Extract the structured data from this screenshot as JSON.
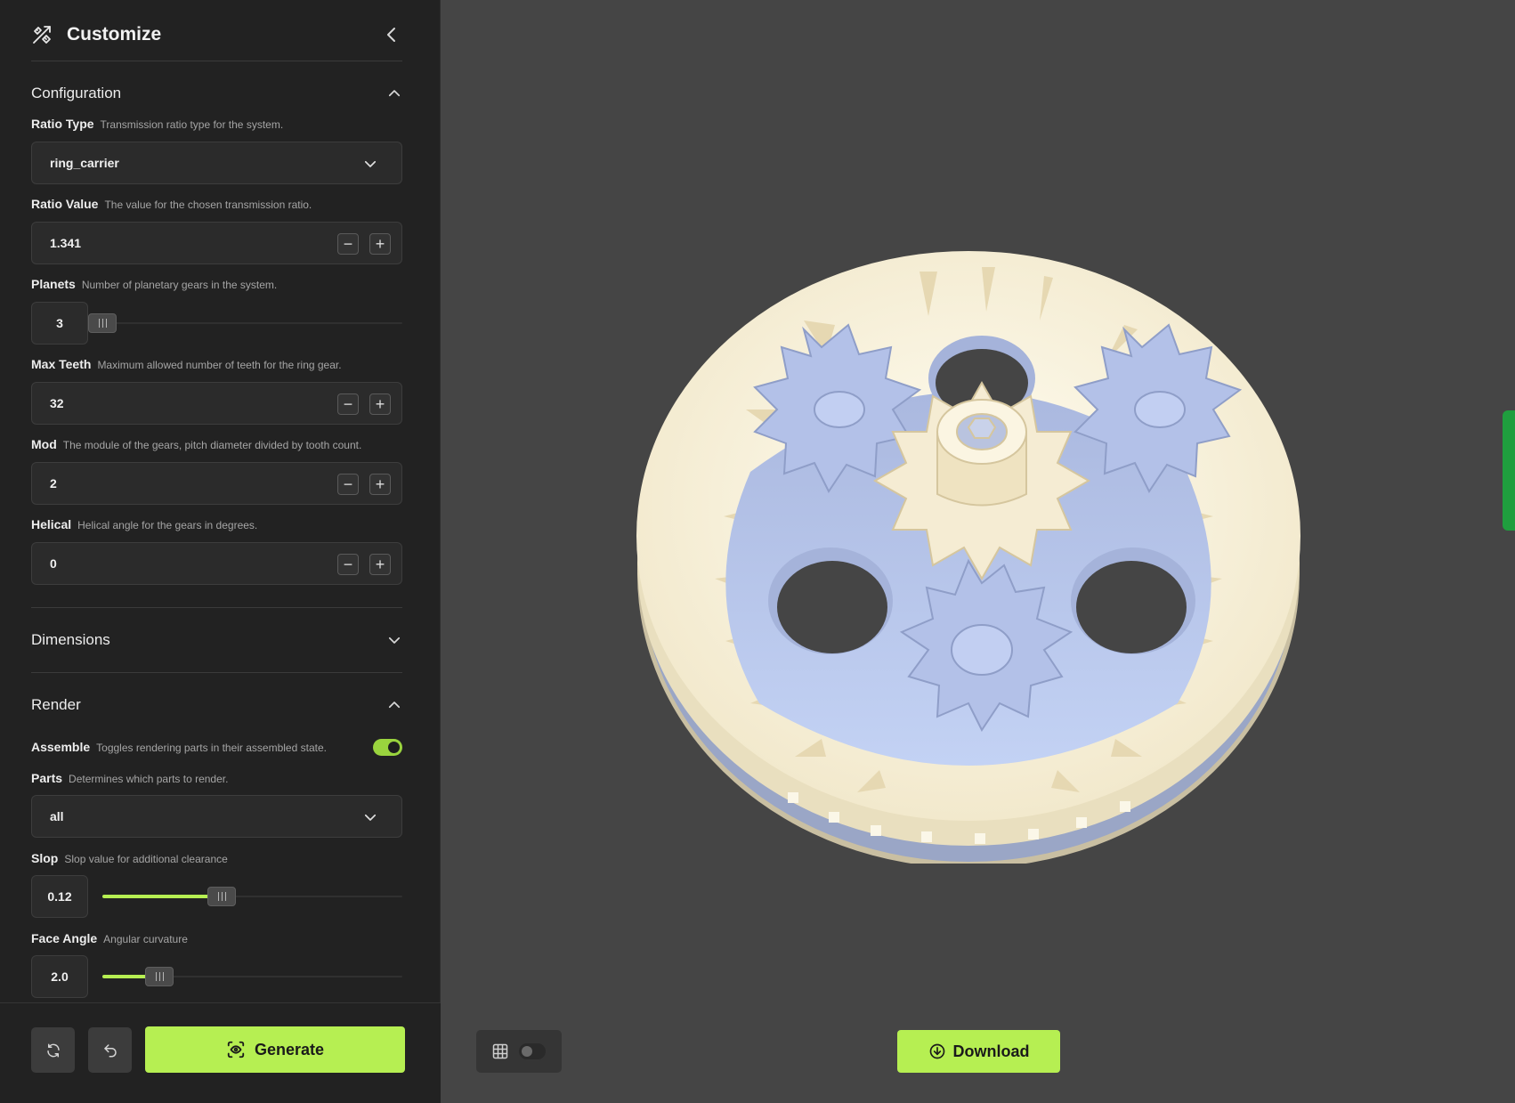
{
  "header": {
    "title": "Customize",
    "icon": "tools-icon",
    "collapse_icon": "chevron-left-icon"
  },
  "configuration": {
    "title": "Configuration",
    "ratio_type": {
      "name": "Ratio Type",
      "desc": "Transmission ratio type for the system.",
      "value": "ring_carrier"
    },
    "ratio_value": {
      "name": "Ratio Value",
      "desc": "The value for the chosen transmission ratio.",
      "value": "1.341"
    },
    "planets": {
      "name": "Planets",
      "desc": "Number of planetary gears in the system.",
      "value": "3",
      "slider_fraction": 0.0
    },
    "max_teeth": {
      "name": "Max Teeth",
      "desc": "Maximum allowed number of teeth for the ring gear.",
      "value": "32"
    },
    "mod": {
      "name": "Mod",
      "desc": "The module of the gears, pitch diameter divided by tooth count.",
      "value": "2"
    },
    "helical": {
      "name": "Helical",
      "desc": "Helical angle for the gears in degrees.",
      "value": "0"
    }
  },
  "dimensions": {
    "title": "Dimensions"
  },
  "render": {
    "title": "Render",
    "assemble": {
      "name": "Assemble",
      "desc": "Toggles rendering parts in their assembled state.",
      "on": true
    },
    "parts": {
      "name": "Parts",
      "desc": "Determines which parts to render.",
      "value": "all"
    },
    "slop": {
      "name": "Slop",
      "desc": "Slop value for additional clearance",
      "value": "0.12",
      "slider_fraction": 0.4
    },
    "face_angle": {
      "name": "Face Angle",
      "desc": "Angular curvature",
      "value": "2.0",
      "slider_fraction": 0.18
    }
  },
  "footer": {
    "reset_icon": "refresh-icon",
    "undo_icon": "undo-icon",
    "generate_label": "Generate"
  },
  "viewport": {
    "download_label": "Download",
    "grid_toggle_on": false
  },
  "colors": {
    "accent": "#b6ef52",
    "sidebar_bg": "#222222",
    "viewport_bg": "#454545",
    "gear_blue": "#bccbef",
    "gear_cream": "#f8f2dc"
  }
}
